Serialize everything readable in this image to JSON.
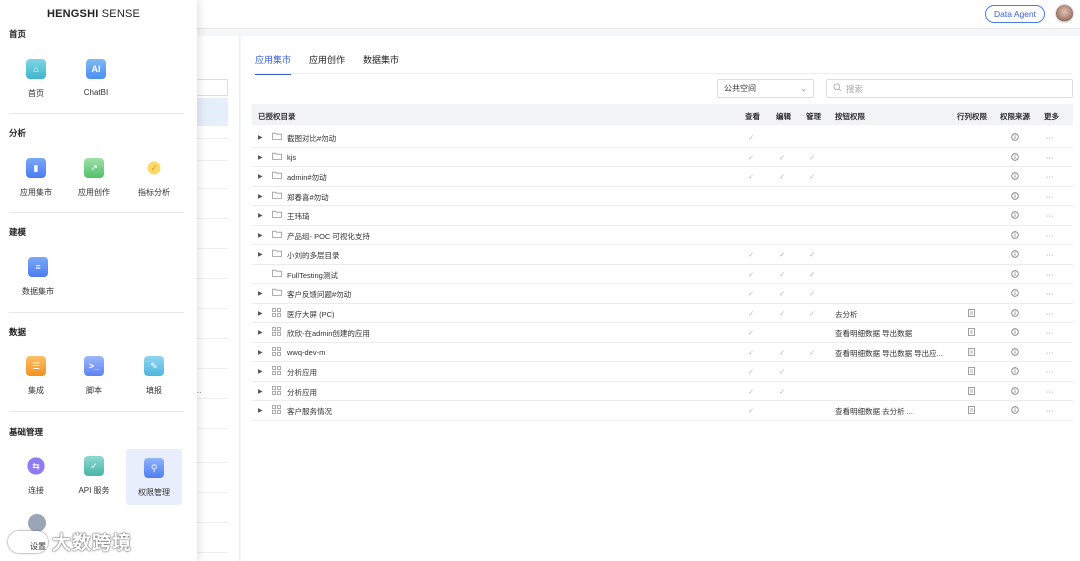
{
  "header": {
    "data_agent_label": "Data Agent"
  },
  "brand": {
    "bold": "HENGSHI",
    "light": " SENSE"
  },
  "nav": {
    "sections": {
      "home": "首页",
      "analysis": "分析",
      "modeling": "建模",
      "data": "数据",
      "admin": "基础管理"
    },
    "items": {
      "home": "首页",
      "chatbi": "ChatBI",
      "app_market": "应用集市",
      "app_create": "应用创作",
      "metric": "指标分析",
      "dataset_market": "数据集市",
      "integration": "集成",
      "script": "脚本",
      "fill": "填报",
      "connect": "连接",
      "api": "API 服务",
      "permission": "权限管理",
      "settings": "设置"
    },
    "active_item": "权限管理"
  },
  "watermark": "大数跨境",
  "mid_panel": {
    "ellipsis": ".."
  },
  "tabs": [
    {
      "label": "应用集市",
      "active": true
    },
    {
      "label": "应用创作",
      "active": false
    },
    {
      "label": "数据集市",
      "active": false
    }
  ],
  "filter": {
    "space_select": "公共空间",
    "search_placeholder": "搜索"
  },
  "table": {
    "headers": {
      "dir": "已授权目录",
      "view": "查看",
      "edit": "编辑",
      "manage": "管理",
      "button_perm": "按钮权限",
      "row_col_perm": "行列权限",
      "perm_source": "权限来源",
      "more": "更多"
    },
    "rows": [
      {
        "name": "截图对比#勿动",
        "kind": "folder",
        "expand": true,
        "view": true,
        "edit": false,
        "manage": false,
        "buttons": "",
        "rowcol": false
      },
      {
        "name": "kjs",
        "kind": "folder",
        "expand": true,
        "view": true,
        "edit": true,
        "manage": true,
        "buttons": "",
        "rowcol": false
      },
      {
        "name": "admin#勿动",
        "kind": "folder",
        "expand": true,
        "view": true,
        "edit": true,
        "manage": true,
        "buttons": "",
        "rowcol": false
      },
      {
        "name": "郑春喜#勿动",
        "kind": "folder",
        "expand": true,
        "view": false,
        "edit": false,
        "manage": false,
        "buttons": "",
        "rowcol": false
      },
      {
        "name": "王玮琦",
        "kind": "folder",
        "expand": true,
        "view": false,
        "edit": false,
        "manage": false,
        "buttons": "",
        "rowcol": false
      },
      {
        "name": "产品组- POC 可视化支持",
        "kind": "folder",
        "expand": true,
        "view": false,
        "edit": false,
        "manage": false,
        "buttons": "",
        "rowcol": false
      },
      {
        "name": "小刘的多层目录",
        "kind": "folder",
        "expand": true,
        "view": true,
        "edit": true,
        "manage": true,
        "buttons": "",
        "rowcol": false
      },
      {
        "name": "FullTesting测试",
        "kind": "folder",
        "expand": false,
        "view": true,
        "edit": true,
        "manage": true,
        "buttons": "",
        "rowcol": false
      },
      {
        "name": "客户反馈问题#勿动",
        "kind": "folder",
        "expand": true,
        "view": true,
        "edit": true,
        "manage": true,
        "buttons": "",
        "rowcol": false
      },
      {
        "name": "医疗大屏 (PC)",
        "kind": "app",
        "expand": true,
        "view": true,
        "edit": true,
        "manage": true,
        "buttons": "去分析",
        "rowcol": true
      },
      {
        "name": "欣欣-在admin创建的应用",
        "kind": "app",
        "expand": true,
        "view": true,
        "edit": false,
        "manage": false,
        "buttons": "查看明细数据  导出数据",
        "rowcol": true
      },
      {
        "name": "wwq-dev-m",
        "kind": "app",
        "expand": true,
        "view": true,
        "edit": true,
        "manage": true,
        "buttons": "查看明细数据  导出数据  导出应...",
        "rowcol": true
      },
      {
        "name": "分析应用",
        "kind": "app",
        "expand": true,
        "view": true,
        "edit": true,
        "manage": false,
        "buttons": "",
        "rowcol": true
      },
      {
        "name": "分析应用",
        "kind": "app",
        "expand": true,
        "view": true,
        "edit": true,
        "manage": false,
        "buttons": "",
        "rowcol": true
      },
      {
        "name": "客户服务情况",
        "kind": "app",
        "expand": true,
        "view": true,
        "edit": false,
        "manage": false,
        "buttons": "查看明细数据  去分析  ...",
        "rowcol": true
      }
    ]
  }
}
